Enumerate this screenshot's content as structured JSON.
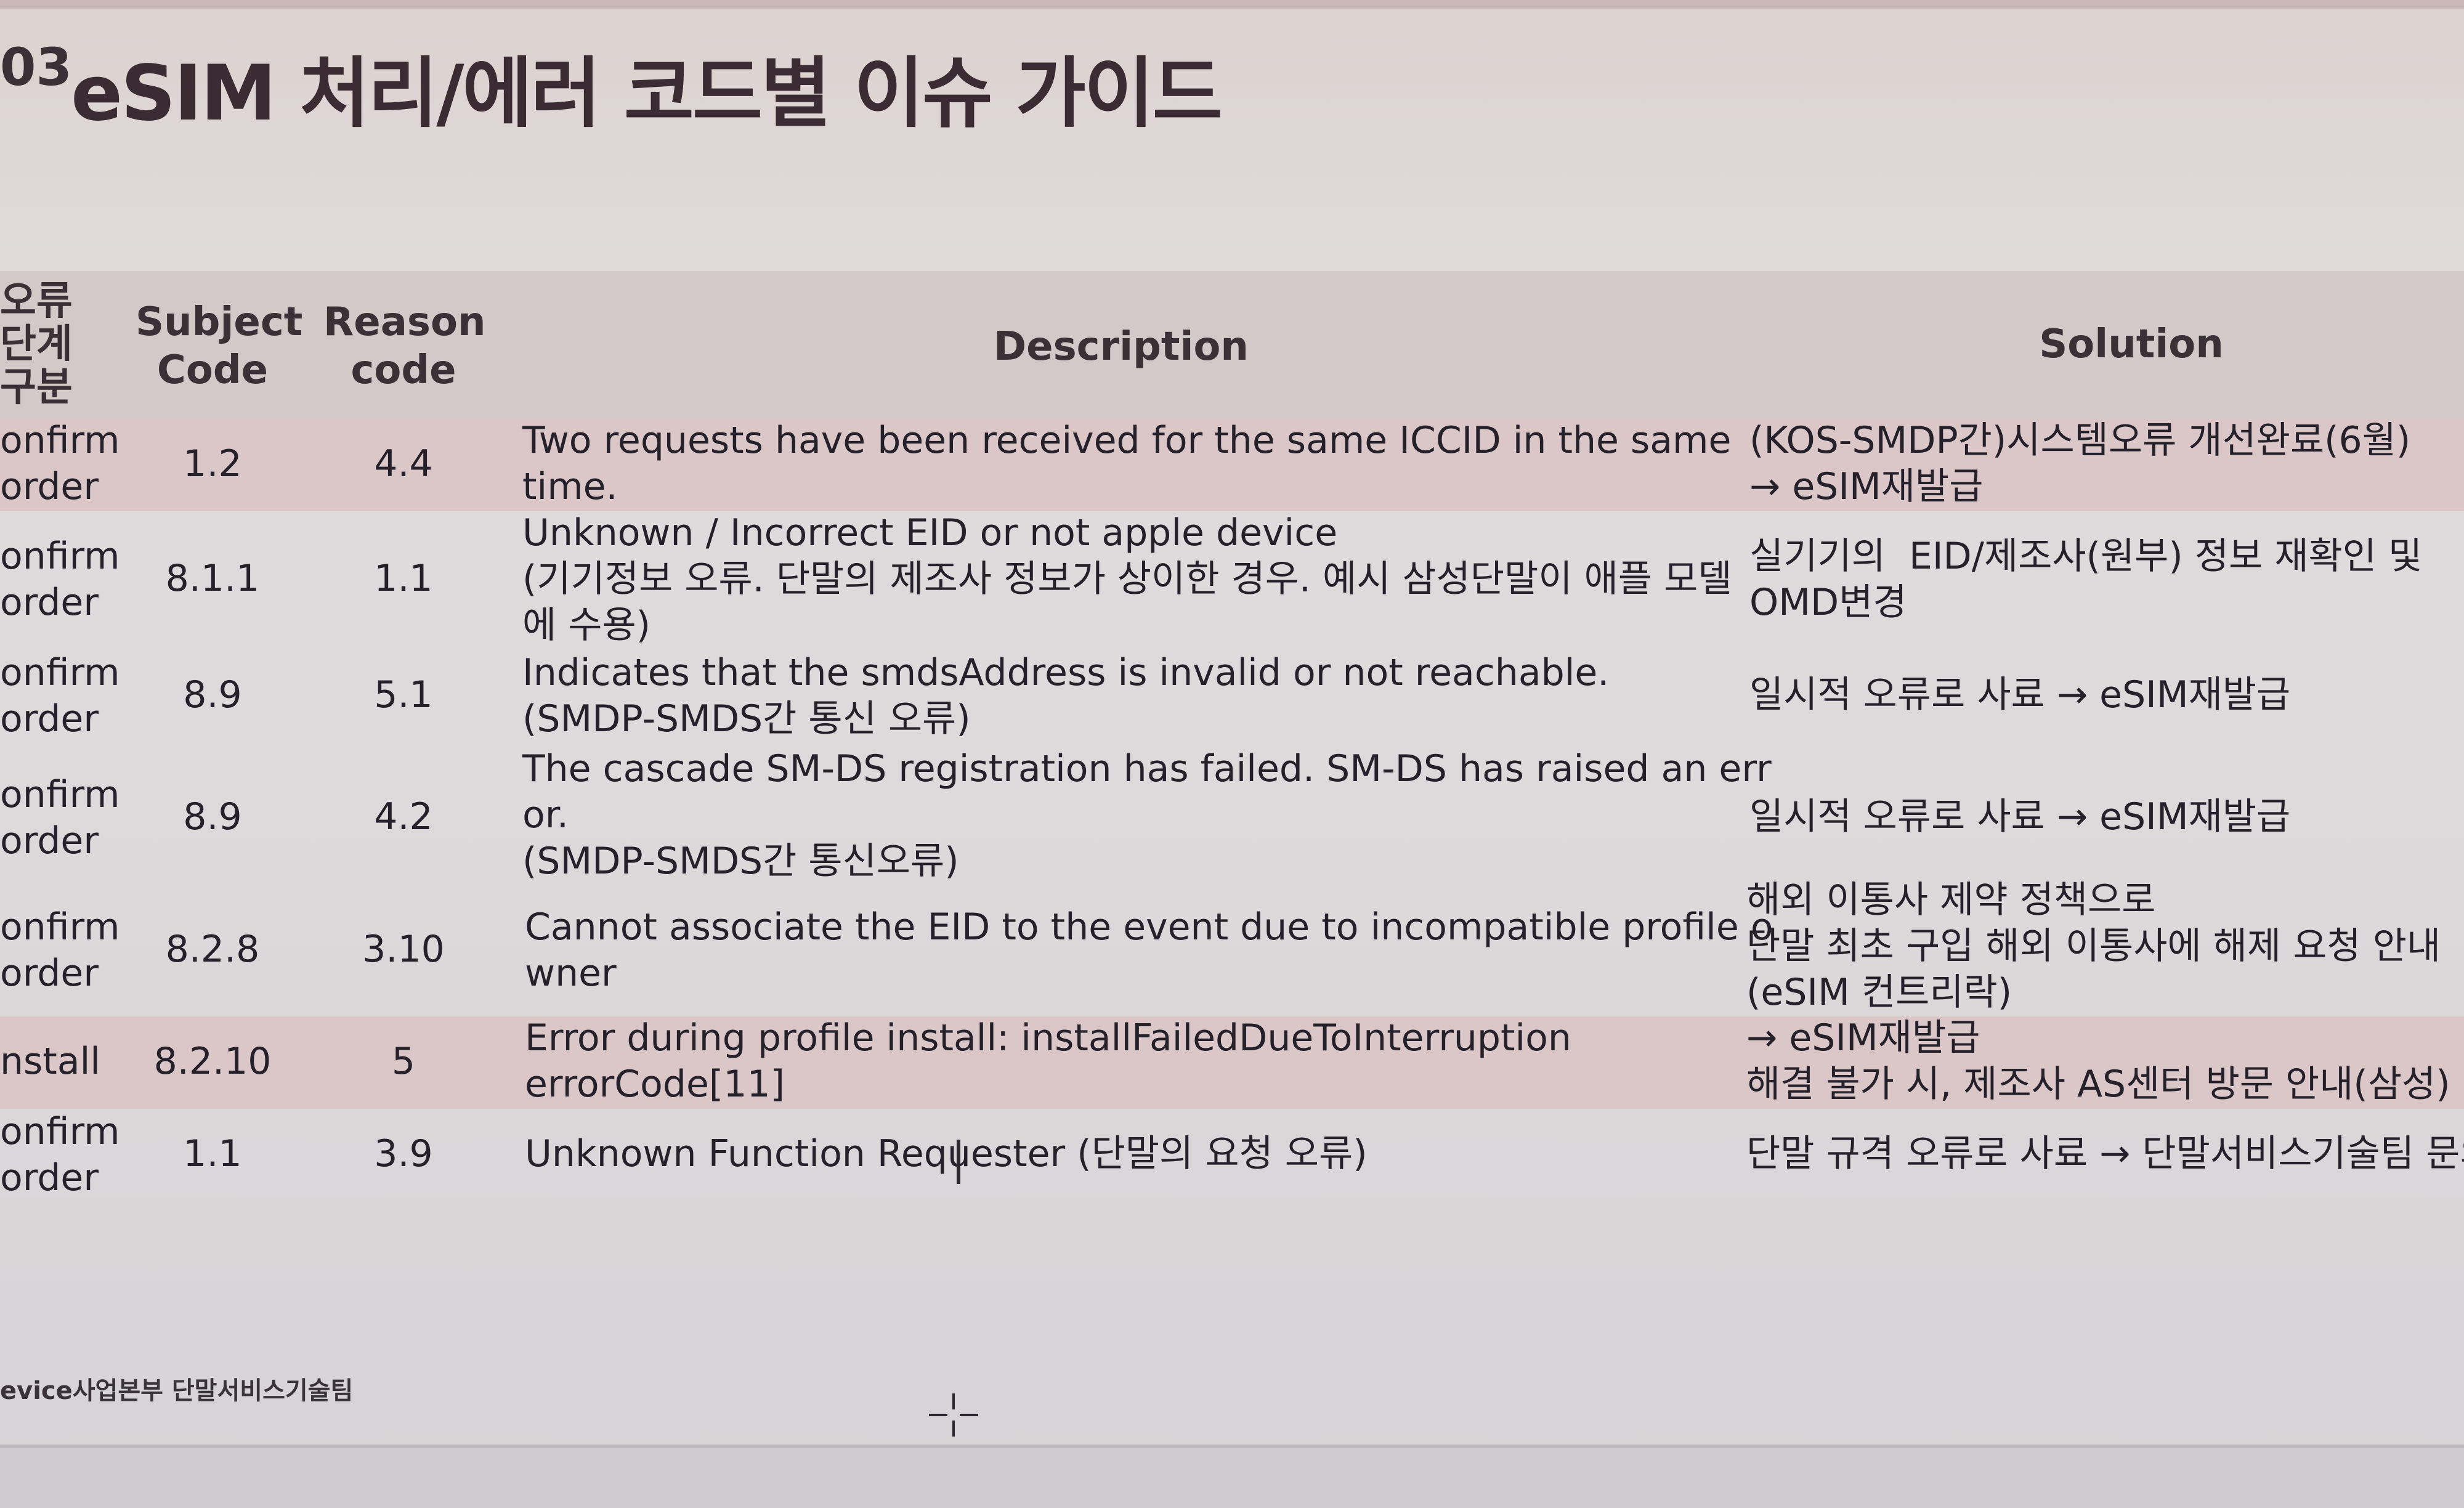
{
  "title": {
    "number": "03",
    "text": "eSIM 처리/에러 코드별 이슈 가이드"
  },
  "table": {
    "headers": {
      "stage": "오류\n단계\n구분",
      "subject": "Subject\nCode",
      "reason": "Reason\ncode",
      "description": "Description",
      "solution": "Solution"
    },
    "rows": [
      {
        "stage": "onfirm\norder",
        "subject": "1.2",
        "reason": "4.4",
        "description": "Two requests have been received for the same ICCID in the same\ntime.",
        "solution": "(KOS-SMDP간)시스템오류 개선완료(6월)\n→ eSIM재발급"
      },
      {
        "stage": "onfirm\norder",
        "subject": "8.1.1",
        "reason": "1.1",
        "description": "Unknown / Incorrect EID or not apple device\n(기기정보 오류. 단말의 제조사 정보가 상이한 경우. 예시 삼성단말이 애플 모델\n에 수용)",
        "solution": "실기기의  EID/제조사(원부) 정보 재확인 및\nOMD변경"
      },
      {
        "stage": "onfirm\norder",
        "subject": "8.9",
        "reason": "5.1",
        "description": "Indicates that the smdsAddress is invalid or not reachable.\n(SMDP-SMDS간 통신 오류)",
        "solution": "일시적 오류로 사료 → eSIM재발급"
      },
      {
        "stage": "onfirm\norder",
        "subject": "8.9",
        "reason": "4.2",
        "description": "The cascade SM-DS registration has failed. SM-DS has raised an err\nor.\n(SMDP-SMDS간 통신오류)",
        "solution": "일시적 오류로 사료 → eSIM재발급"
      },
      {
        "stage": "onfirm\norder",
        "subject": "8.2.8",
        "reason": "3.10",
        "description": "Cannot associate the EID to the event due to incompatible profile o\nwner",
        "solution": "해외 이통사 제약 정책으로\n단말 최초 구입 해외 이통사에 해제 요청 안내\n(eSIM 컨트리락)"
      },
      {
        "stage": "nstall",
        "subject": "8.2.10",
        "reason": "5",
        "description": "Error during profile install: installFailedDueToInterruption\nerrorCode[11]",
        "solution": "→ eSIM재발급\n해결 불가 시, 제조사 AS센터 방문 안내(삼성)"
      },
      {
        "stage": "onfirm\norder",
        "subject": "1.1",
        "reason": "3.9",
        "description": "Unknown Function Requester (단말의 요청 오류)",
        "solution": "단말 규격 오류로 사료 → 단말서비스기술팀 문의"
      }
    ]
  },
  "footer": {
    "text": "evice사업본부 단말서비스기술팀"
  }
}
